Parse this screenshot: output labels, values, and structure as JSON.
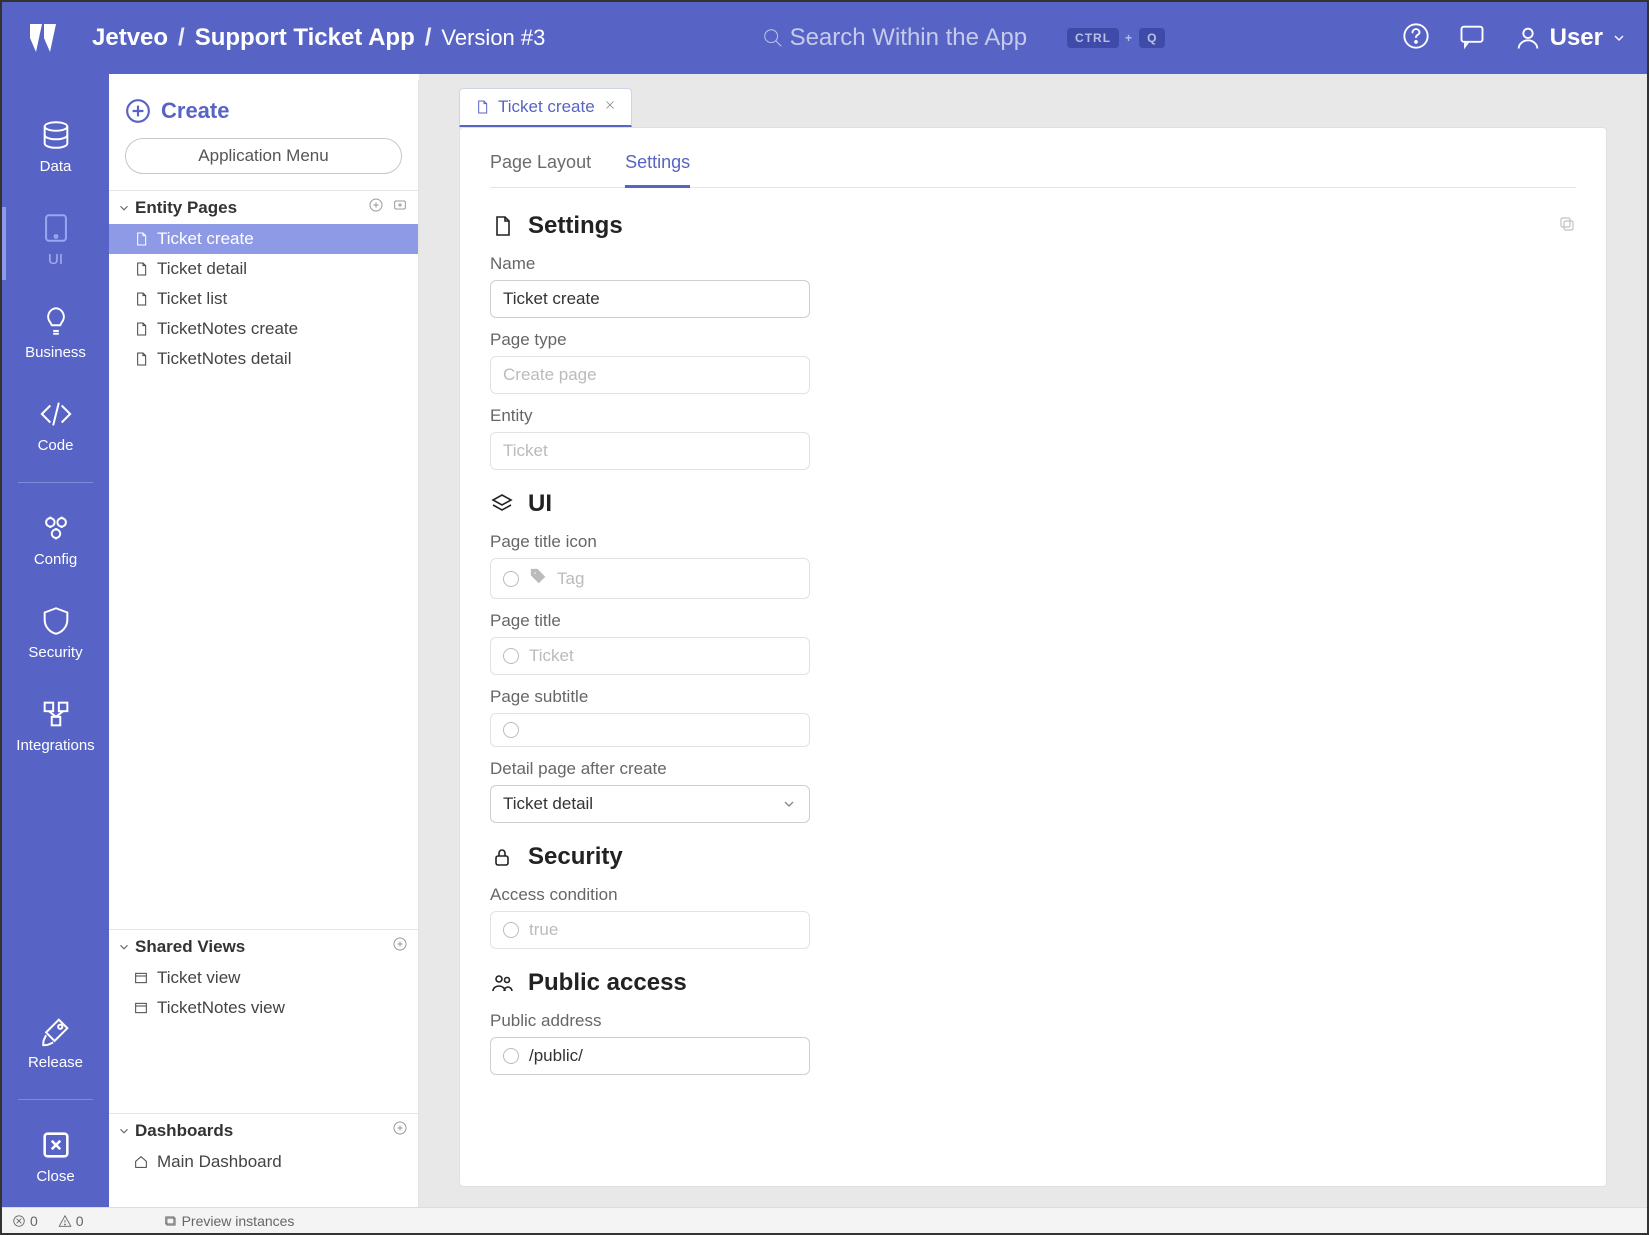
{
  "header": {
    "platform": "Jetveo",
    "app_name": "Support Ticket App",
    "version_label": "Version #3",
    "search_placeholder": "Search Within the App",
    "kbd1": "CTRL",
    "kbd_plus": "+",
    "kbd2": "Q",
    "user_label": "User"
  },
  "leftnav": {
    "items": [
      {
        "label": "Data"
      },
      {
        "label": "UI"
      },
      {
        "label": "Business"
      },
      {
        "label": "Code"
      },
      {
        "label": "Config"
      },
      {
        "label": "Security"
      },
      {
        "label": "Integrations"
      }
    ],
    "release": "Release",
    "close": "Close"
  },
  "side_panel": {
    "create_label": "Create",
    "app_menu_label": "Application Menu",
    "entity_pages_label": "Entity Pages",
    "entity_pages": [
      "Ticket create",
      "Ticket detail",
      "Ticket list",
      "TicketNotes create",
      "TicketNotes detail"
    ],
    "shared_views_label": "Shared Views",
    "shared_views": [
      "Ticket view",
      "TicketNotes view"
    ],
    "dashboards_label": "Dashboards",
    "dashboards": [
      "Main Dashboard"
    ]
  },
  "tabs": {
    "open_tab": "Ticket create"
  },
  "doc": {
    "inner_tabs": {
      "layout": "Page Layout",
      "settings": "Settings"
    },
    "settings_heading": "Settings",
    "name_label": "Name",
    "name_value": "Ticket create",
    "pagetype_label": "Page type",
    "pagetype_value": "Create page",
    "entity_label": "Entity",
    "entity_value": "Ticket",
    "ui_heading": "UI",
    "icon_label": "Page title icon",
    "icon_value": "Tag",
    "title_label": "Page title",
    "title_value": "Ticket",
    "subtitle_label": "Page subtitle",
    "detail_label": "Detail page after create",
    "detail_value": "Ticket detail",
    "security_heading": "Security",
    "access_label": "Access condition",
    "access_value": "true",
    "public_heading": "Public access",
    "public_addr_label": "Public address",
    "public_addr_value": "/public/"
  },
  "status": {
    "errors": "0",
    "warnings": "0",
    "preview": "Preview instances"
  }
}
